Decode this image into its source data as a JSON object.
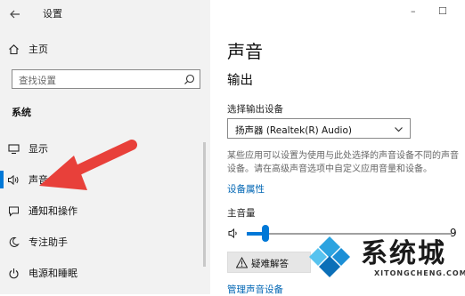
{
  "window": {
    "title": "设置",
    "minimize": "–",
    "maximize": "☐"
  },
  "sidebar": {
    "home": "主页",
    "search_placeholder": "查找设置",
    "section_label": "系统",
    "items": [
      {
        "label": "显示",
        "icon": "display-icon",
        "active": false
      },
      {
        "label": "声音",
        "icon": "speaker-icon",
        "active": true
      },
      {
        "label": "通知和操作",
        "icon": "notification-icon",
        "active": false
      },
      {
        "label": "专注助手",
        "icon": "moon-icon",
        "active": false
      },
      {
        "label": "电源和睡眠",
        "icon": "power-icon",
        "active": false
      }
    ]
  },
  "main": {
    "page_title": "声音",
    "output_heading": "输出",
    "choose_output_label": "选择输出设备",
    "output_device": "扬声器 (Realtek(R) Audio)",
    "description": "某些应用可以设置为使用与此处选择的声音设备不同的声音设备。请在高级声音选项中自定义应用音量和设备。",
    "device_properties_link": "设备属性",
    "master_volume_label": "主音量",
    "volume_value": "9",
    "volume_level": 0.09,
    "troubleshoot_label": "疑难解答",
    "manage_devices_link": "管理声音设备"
  },
  "watermark": {
    "brand": "系统城",
    "url": "XITONGCHENG.COM"
  },
  "colors": {
    "accent": "#0078d7",
    "arrow": "#e8403a",
    "link": "#0066b4",
    "sidebar_bg": "#f2f2f2"
  }
}
